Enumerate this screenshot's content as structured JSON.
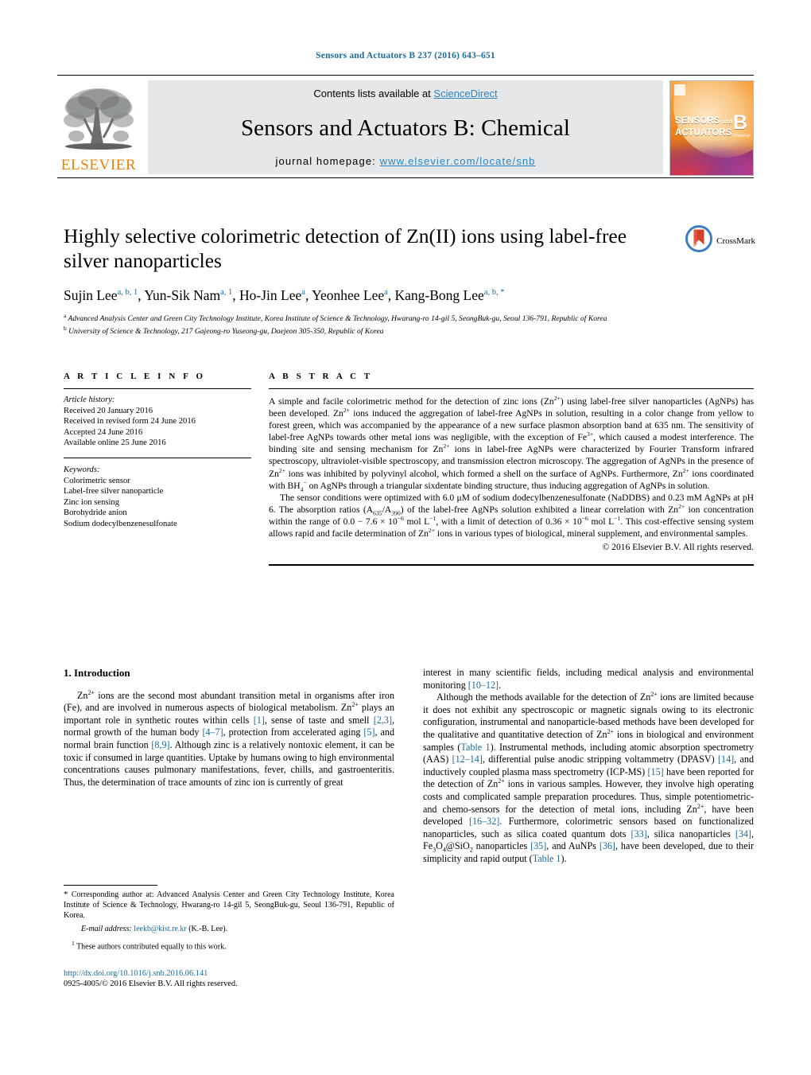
{
  "running_head": "Sensors and Actuators B 237 (2016) 643–651",
  "masthead": {
    "contents_prefix": "Contents lists available at ",
    "sciencedirect": "ScienceDirect",
    "journal_title": "Sensors and Actuators B: Chemical",
    "homepage_label": "journal homepage: ",
    "homepage_url": "www.elsevier.com/locate/snb",
    "publisher_wordmark": "ELSEVIER",
    "cover": {
      "line1": "SENSORS",
      "and": "and",
      "line2": "ACTUATORS",
      "letter": "B",
      "sublabel": "Chemical"
    },
    "link_color": "#2a84c6",
    "elsevier_orange": "#f08000"
  },
  "article": {
    "title": "Highly selective colorimetric detection of Zn(II) ions using label-free silver nanoparticles",
    "crossmark_label": "CrossMark",
    "authors": [
      {
        "name": "Sujin Lee",
        "sup": "a, b, 1"
      },
      {
        "name": "Yun-Sik Nam",
        "sup": "a, 1"
      },
      {
        "name": "Ho-Jin Lee",
        "sup": "a"
      },
      {
        "name": "Yeonhee Lee",
        "sup": "a"
      },
      {
        "name": "Kang-Bong Lee",
        "sup": "a, b, *"
      }
    ],
    "affiliations": [
      {
        "marker": "a",
        "text": "Advanced Analysis Center and Green City Technology Institute, Korea Institute of Science & Technology, Hwarang-ro 14-gil 5, SeongBuk-gu, Seoul 136-791, Republic of Korea"
      },
      {
        "marker": "b",
        "text": "University of Science & Technology, 217 Gajeong-ro Yuseong-gu, Daejeon 305-350, Republic of Korea"
      }
    ]
  },
  "article_info": {
    "heading": "A R T I C L E   I N F O",
    "history_label": "Article history:",
    "history": [
      "Received 20 January 2016",
      "Received in revised form 24 June 2016",
      "Accepted 24 June 2016",
      "Available online 25 June 2016"
    ],
    "keywords_label": "Keywords:",
    "keywords": [
      "Colorimetric sensor",
      "Label-free silver nanoparticle",
      "Zinc ion sensing",
      "Borohydride anion",
      "Sodium dodecylbenzenesulfonate"
    ]
  },
  "abstract": {
    "heading": "A B S T R A C T",
    "paragraph1_html": "A simple and facile colorimetric method for the detection of zinc ions (Zn<sup class=\"sm\">2+</sup>) using label-free silver nanoparticles (AgNPs) has been developed. Zn<sup class=\"sm\">2+</sup> ions induced the aggregation of label-free AgNPs in solution, resulting in a color change from yellow to forest green, which was accompanied by the appearance of a new surface plasmon absorption band at 635 nm. The sensitivity of label-free AgNPs towards other metal ions was negligible, with the exception of Fe<sup class=\"sm\">3+</sup>, which caused a modest interference. The binding site and sensing mechanism for Zn<sup class=\"sm\">2+</sup> ions in label-free AgNPs were characterized by Fourier Transform infrared spectroscopy, ultraviolet-visible spectroscopy, and transmission electron microscopy. The aggregation of AgNPs in the presence of Zn<sup class=\"sm\">2+</sup> ions was inhibited by polyvinyl alcohol, which formed a shell on the surface of AgNPs. Furthermore, Zn<sup class=\"sm\">2+</sup> ions coordinated with BH<sub class=\"sm\">4</sub><sup class=\"sm\">−</sup> on AgNPs through a triangular sixdentate binding structure, thus inducing aggregation of AgNPs in solution.",
    "paragraph2_html": "The sensor conditions were optimized with 6.0 &#956;M of sodium dodecylbenzenesulfonate (NaDDBS) and 0.23 mM AgNPs at pH 6. The absorption ratios (A<sub class=\"sm\">635</sub>/A<sub class=\"sm\">390</sub>) of the label-free AgNPs solution exhibited a linear correlation with Zn<sup class=\"sm\">2+</sup> ion concentration within the range of 0.0 − 7.6 &#215; 10<sup class=\"sm\">−6</sup> mol L<sup class=\"sm\">−1</sup>, with a limit of detection of 0.36 &#215; 10<sup class=\"sm\">−6</sup> mol L<sup class=\"sm\">−1</sup>. This cost-effective sensing system allows rapid and facile determination of Zn<sup class=\"sm\">2+</sup> ions in various types of biological, mineral supplement, and environmental samples.",
    "copyright": "© 2016 Elsevier B.V. All rights reserved."
  },
  "introduction": {
    "heading": "1.  Introduction",
    "left_html": "Zn<sup class=\"sm\">2+</sup> ions are the second most abundant transition metal in organisms after iron (Fe), and are involved in numerous aspects of biological metabolism. Zn<sup class=\"sm\">2+</sup> plays an important role in synthetic routes within cells <span class=\"lnk\">[1]</span>, sense of taste and smell <span class=\"lnk\">[2,3]</span>, normal growth of the human body <span class=\"lnk\">[4–7]</span>, protection from accelerated aging <span class=\"lnk\">[5]</span>, and normal brain function <span class=\"lnk\">[8,9]</span>. Although zinc is a relatively nontoxic element, it can be toxic if consumed in large quantities. Uptake by humans owing to high environmental concentrations causes pulmonary manifestations, fever, chills, and gastroenteritis. Thus, the determination of trace amounts of zinc ion is currently of great",
    "right_para1_html": "interest in many scientific fields, including medical analysis and environmental monitoring <span class=\"lnk\">[10–12]</span>.",
    "right_para2_html": "Although the methods available for the detection of Zn<sup class=\"sm\">2+</sup> ions are limited because it does not exhibit any spectroscopic or magnetic signals owing to its electronic configuration, instrumental and nanoparticle-based methods have been developed for the qualitative and quantitative detection of Zn<sup class=\"sm\">2+</sup> ions in biological and environment samples (<span class=\"lnk\">Table 1</span>). Instrumental methods, including atomic absorption spectrometry (AAS) <span class=\"lnk\">[12–14]</span>, differential pulse anodic stripping voltammetry (DPASV) <span class=\"lnk\">[14]</span>, and inductively coupled plasma mass spectrometry (ICP-MS) <span class=\"lnk\">[15]</span> have been reported for the detection of Zn<sup class=\"sm\">2+</sup> ions in various samples. However, they involve high operating costs and complicated sample preparation procedures. Thus, simple potentiometric- and chemo-sensors for the detection of metal ions, including Zn<sup class=\"sm\">2+</sup>, have been developed <span class=\"lnk\">[16–32]</span>. Furthermore, colorimetric sensors based on functionalized nanoparticles, such as silica coated quantum dots <span class=\"lnk\">[33]</span>, silica nanoparticles <span class=\"lnk\">[34]</span>, Fe<sub class=\"sm\">3</sub>O<sub class=\"sm\">4</sub>@SiO<sub class=\"sm\">2</sub> nanoparticles <span class=\"lnk\">[35]</span>, and AuNPs <span class=\"lnk\">[36]</span>, have been developed, due to their simplicity and rapid output (<span class=\"lnk\">Table 1</span>)."
  },
  "footnotes": {
    "corresponding_html": "<span class=\"star\">*</span>  Corresponding author at: Advanced Analysis Center and Green City Technology Institute, Korea Institute of Science &amp; Technology, Hwarang-ro 14-gil 5, SeongBuk-gu, Seoul 136-791, Republic of Korea.",
    "email_html": "<span class=\"em\">E-mail address:</span> <span class=\"lnk\">leekb@kist.re.kr</span> (K.-B. Lee).",
    "equal_contrib_html": "<span class=\"fn-sup\">1</span>  These authors contributed equally to this work.",
    "doi": "http://dx.doi.org/10.1016/j.snb.2016.06.141",
    "issn_line": "0925-4005/© 2016 Elsevier B.V. All rights reserved."
  }
}
